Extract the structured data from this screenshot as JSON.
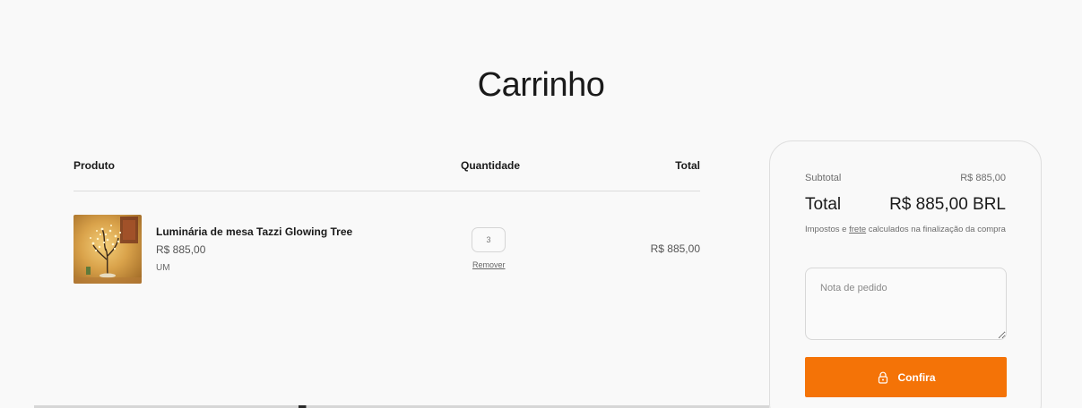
{
  "page": {
    "title": "Carrinho"
  },
  "table": {
    "headers": {
      "product": "Produto",
      "quantity": "Quantidade",
      "total": "Total"
    },
    "items": [
      {
        "name": "Luminária de mesa Tazzi Glowing Tree",
        "price": "R$ 885,00",
        "variant": "UM",
        "quantity": "3",
        "remove_label": "Remover",
        "line_total": "R$ 885,00",
        "image_icon": "glowing-tree-lamp"
      }
    ]
  },
  "summary": {
    "subtotal_label": "Subtotal",
    "subtotal_value": "R$ 885,00",
    "total_label": "Total",
    "total_value": "R$ 885,00 BRL",
    "tax_note_prefix": "Impostos e ",
    "tax_note_link": "frete",
    "tax_note_suffix": " calculados na finalização da compra",
    "note_placeholder": "Nota de pedido",
    "checkout_label": "Confira",
    "checkout_color": "#f47307"
  }
}
